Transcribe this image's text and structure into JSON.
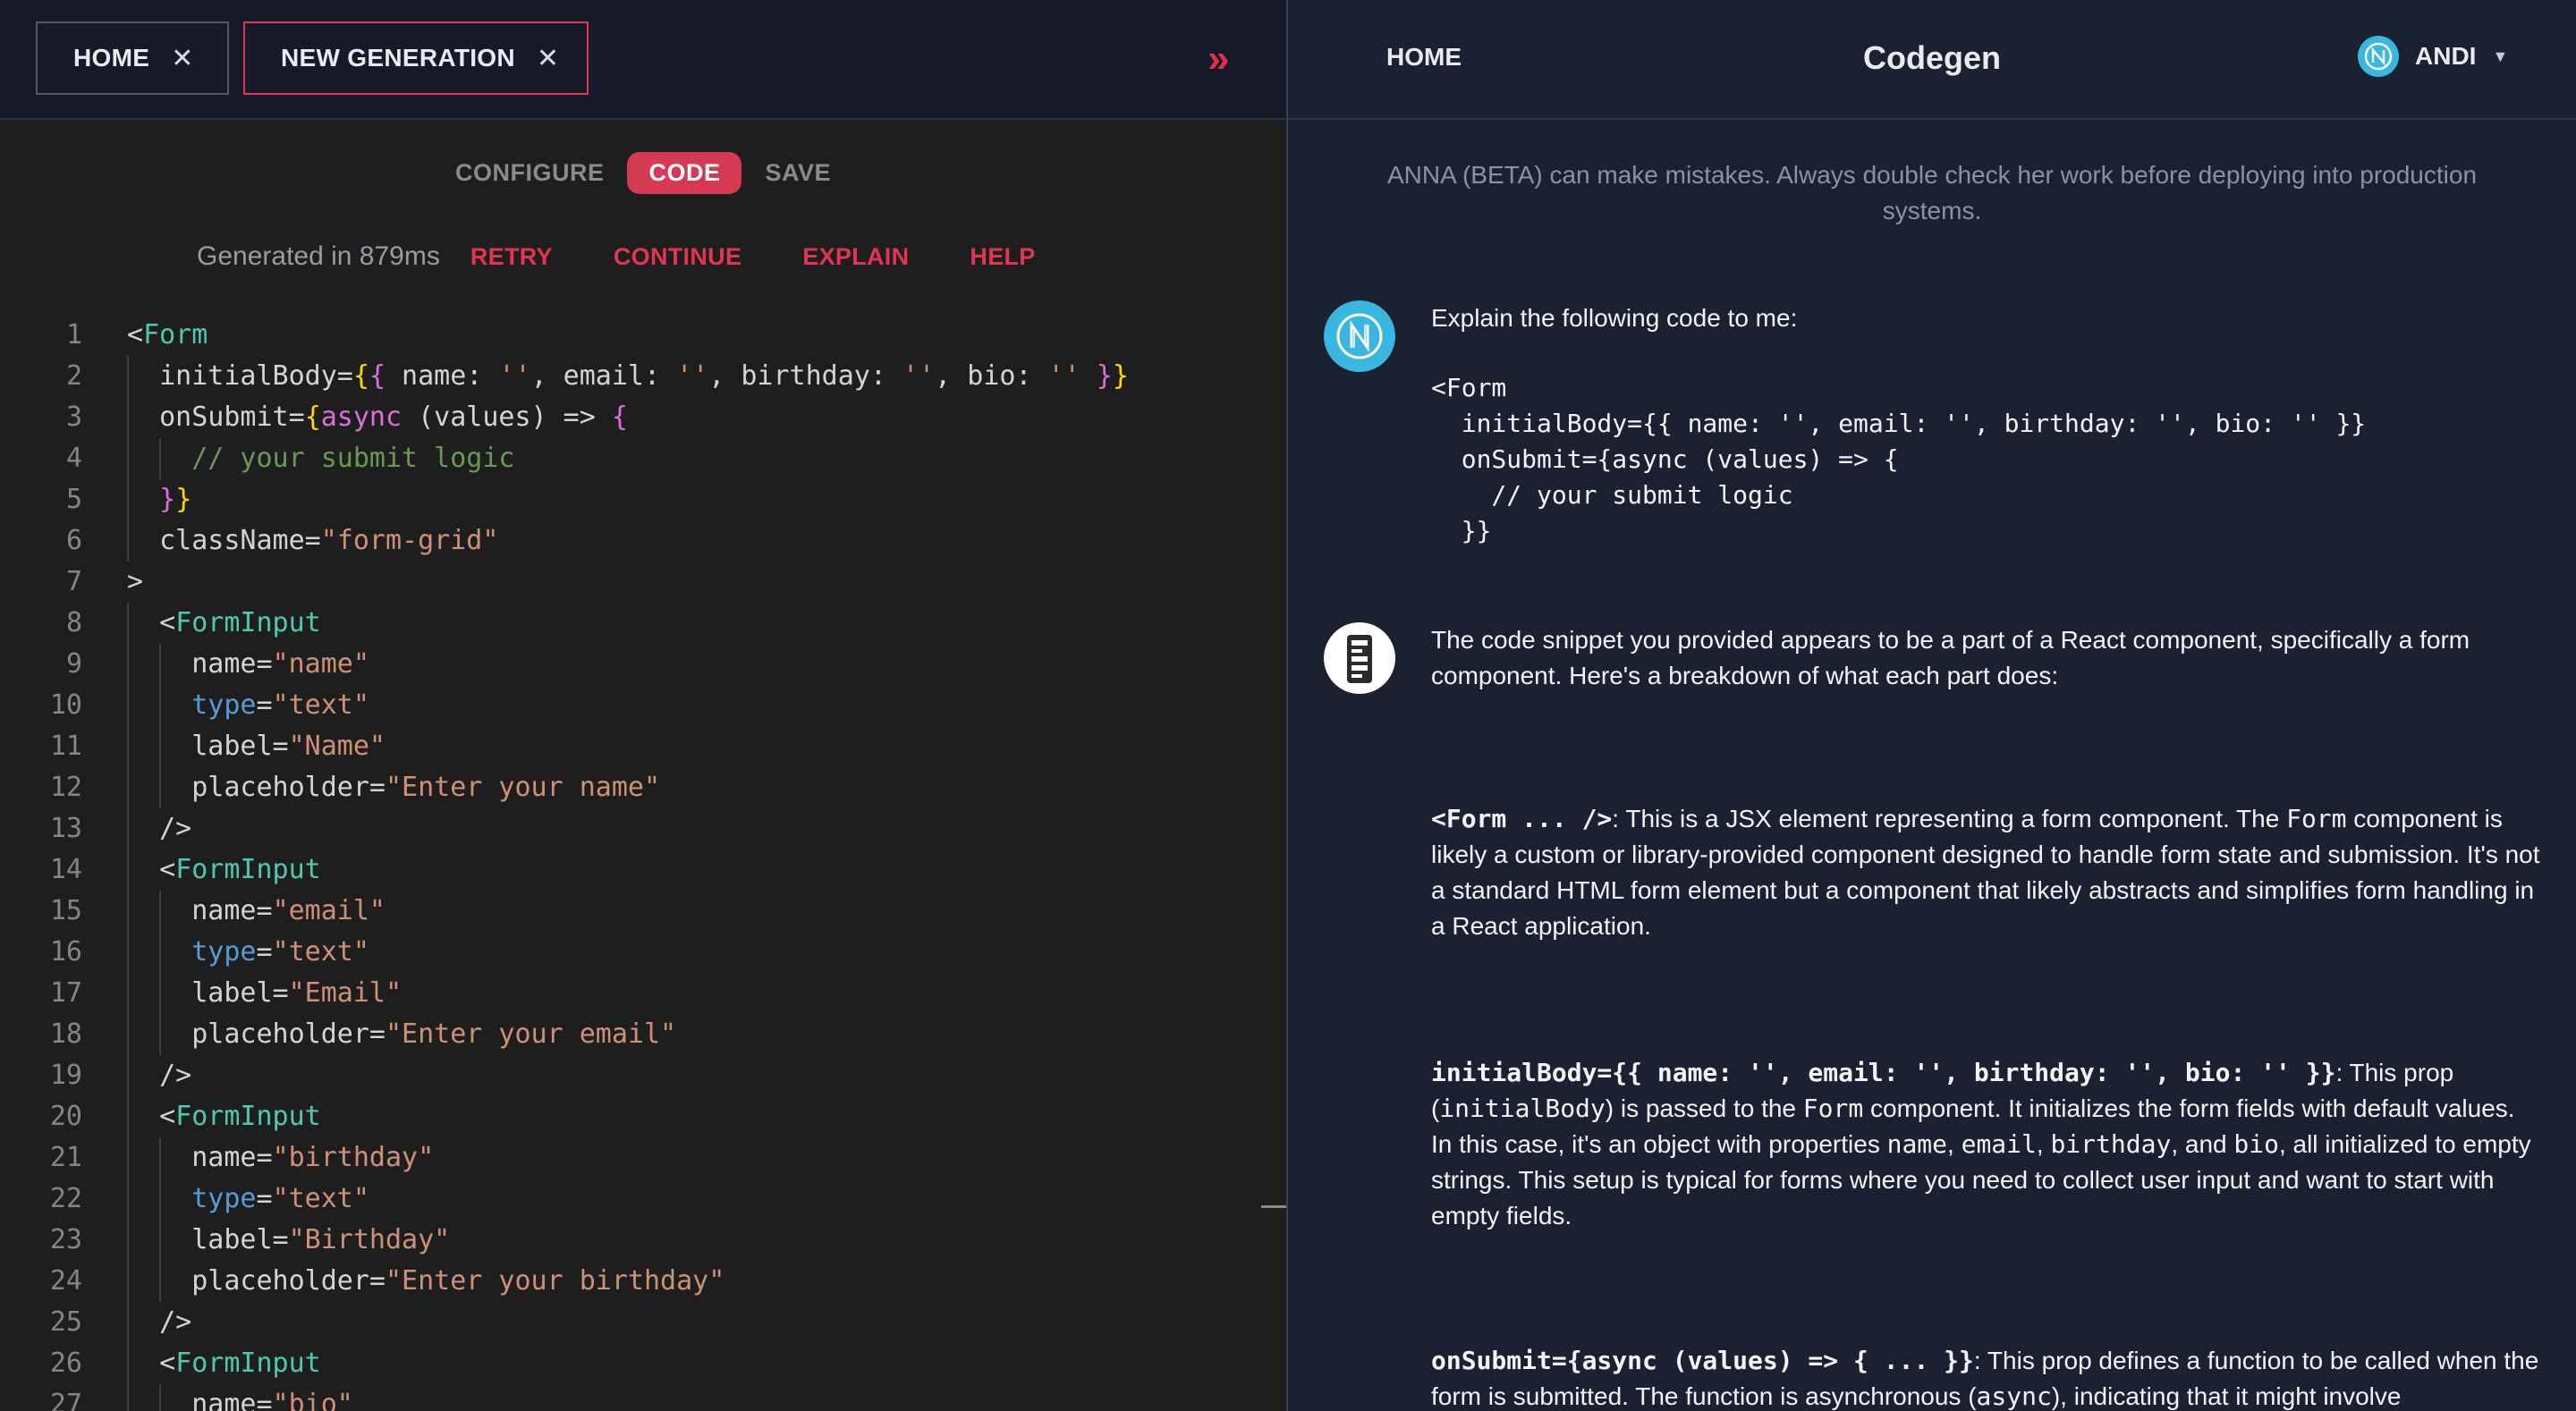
{
  "tabs": [
    {
      "label": "HOME",
      "active": false
    },
    {
      "label": "NEW GENERATION",
      "active": true
    }
  ],
  "toolbar": {
    "modes": [
      "CONFIGURE",
      "CODE",
      "SAVE"
    ],
    "active_mode": "CODE",
    "generated_text": "Generated in 879ms",
    "actions": [
      "RETRY",
      "CONTINUE",
      "EXPLAIN",
      "HELP"
    ]
  },
  "editor": {
    "lines": [
      {
        "n": "1",
        "text": "<Form"
      },
      {
        "n": "2",
        "text": "  initialBody={{ name: '', email: '', birthday: '', bio: '' }}"
      },
      {
        "n": "3",
        "text": "  onSubmit={async (values) => {"
      },
      {
        "n": "4",
        "text": "    // your submit logic"
      },
      {
        "n": "5",
        "text": "  }}"
      },
      {
        "n": "6",
        "text": "  className=\"form-grid\""
      },
      {
        "n": "7",
        "text": ">"
      },
      {
        "n": "8",
        "text": "  <FormInput"
      },
      {
        "n": "9",
        "text": "    name=\"name\""
      },
      {
        "n": "10",
        "text": "    type=\"text\""
      },
      {
        "n": "11",
        "text": "    label=\"Name\""
      },
      {
        "n": "12",
        "text": "    placeholder=\"Enter your name\""
      },
      {
        "n": "13",
        "text": "  />"
      },
      {
        "n": "14",
        "text": "  <FormInput"
      },
      {
        "n": "15",
        "text": "    name=\"email\""
      },
      {
        "n": "16",
        "text": "    type=\"text\""
      },
      {
        "n": "17",
        "text": "    label=\"Email\""
      },
      {
        "n": "18",
        "text": "    placeholder=\"Enter your email\""
      },
      {
        "n": "19",
        "text": "  />"
      },
      {
        "n": "20",
        "text": "  <FormInput"
      },
      {
        "n": "21",
        "text": "    name=\"birthday\""
      },
      {
        "n": "22",
        "text": "    type=\"text\""
      },
      {
        "n": "23",
        "text": "    label=\"Birthday\""
      },
      {
        "n": "24",
        "text": "    placeholder=\"Enter your birthday\""
      },
      {
        "n": "25",
        "text": "  />"
      },
      {
        "n": "26",
        "text": "  <FormInput"
      },
      {
        "n": "27",
        "text": "    name=\"bio\""
      }
    ]
  },
  "header": {
    "home": "HOME",
    "brand": "Codegen",
    "user": "ANDI"
  },
  "chat": {
    "disclaimer": "ANNA (BETA) can make mistakes. Always double check her work before deploying into production systems.",
    "user_message_intro": "Explain the following code to me:",
    "user_message_code": "<Form\n  initialBody={{ name: '', email: '', birthday: '', bio: '' }}\n  onSubmit={async (values) => {\n    // your submit logic\n  }}",
    "bot_intro": "The code snippet you provided appears to be a part of a React component, specifically a form component. Here's a breakdown of what each part does:",
    "bot_sections": [
      {
        "code": "<Form ... />",
        "segments": [
          {
            "t": ": This is a JSX element representing a form component. The ",
            "m": false
          },
          {
            "t": "Form",
            "m": true
          },
          {
            "t": " component is likely a custom or library-provided component designed to handle form state and submission. It's not a standard HTML form element but a component that likely abstracts and simplifies form handling in a React application.",
            "m": false
          }
        ]
      },
      {
        "code": "initialBody={{ name: '', email: '', birthday: '', bio: '' }}",
        "segments": [
          {
            "t": ": This prop (",
            "m": false
          },
          {
            "t": "initialBody",
            "m": true
          },
          {
            "t": ") is passed to the ",
            "m": false
          },
          {
            "t": "Form",
            "m": true
          },
          {
            "t": " component. It initializes the form fields with default values. In this case, it's an object with properties ",
            "m": false
          },
          {
            "t": "name",
            "m": true
          },
          {
            "t": ", ",
            "m": false
          },
          {
            "t": "email",
            "m": true
          },
          {
            "t": ", ",
            "m": false
          },
          {
            "t": "birthday",
            "m": true
          },
          {
            "t": ", and ",
            "m": false
          },
          {
            "t": "bio",
            "m": true
          },
          {
            "t": ", all initialized to empty strings. This setup is typical for forms where you need to collect user input and want to start with empty fields.",
            "m": false
          }
        ]
      },
      {
        "code": "onSubmit={async (values) => { ... }}",
        "segments": [
          {
            "t": ": This prop defines a function to be called when the form is submitted. The function is asynchronous (",
            "m": false
          },
          {
            "t": "async",
            "m": true
          },
          {
            "t": "), indicating that it might involve",
            "m": false
          }
        ]
      }
    ]
  },
  "colors": {
    "accent": "#d63a52",
    "pane_left": "#1e1e1e",
    "pane_right": "#1b2130",
    "avatar_blue": "#39b7e0"
  }
}
